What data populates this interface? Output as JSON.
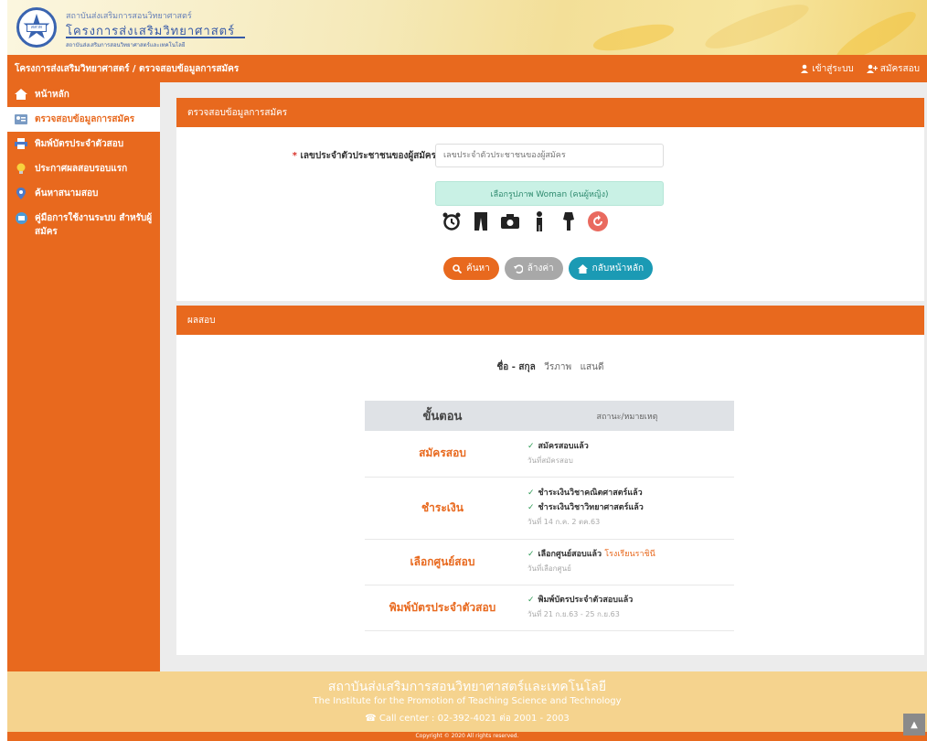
{
  "banner": {
    "line1": "สถาบันส่งเสริมการสอนวิทยาศาสตร์",
    "line2": "โครงการส่งเสริมวิทยาศาสตร์",
    "line3": "สถาบันส่งเสริมการสอนวิทยาศาสตร์และเทคโนโลยี",
    "logo_text": "สสวท"
  },
  "topbar": {
    "breadcrumb": "โครงการส่งเสริมวิทยาศาสตร์ / ตรวจสอบข้อมูลการสมัคร",
    "user_link": "เข้าสู่ระบบ",
    "register_link": "สมัครสอบ"
  },
  "sidebar": {
    "items": [
      {
        "label": "หน้าหลัก",
        "icon": "home-icon"
      },
      {
        "label": "ตรวจสอบข้อมูลการสมัคร",
        "icon": "id-card-icon"
      },
      {
        "label": "พิมพ์บัตรประจำตัวสอบ",
        "icon": "printer-icon"
      },
      {
        "label": "ประกาศผลสอบรอบแรก",
        "icon": "lightbulb-icon"
      },
      {
        "label": "ค้นหาสนามสอบ",
        "icon": "map-pin-icon"
      },
      {
        "label": "คู่มือการใช้งานระบบ สำหรับผู้สมัคร",
        "icon": "book-icon"
      }
    ]
  },
  "check_panel": {
    "title": "ตรวจสอบข้อมูลการสมัคร",
    "id_label": "เลขประจำตัวประชาชนของผู้สมัคร",
    "id_placeholder": "เลขประจำตัวประชาชนของผู้สมัคร",
    "notice": "เลือกรูปภาพ Woman (คนผู้หญิง)",
    "captcha_icons": [
      "alarm-clock-icon",
      "pants-icon",
      "camera-icon",
      "person-icon",
      "dress-icon",
      "refresh-icon"
    ],
    "buttons": {
      "search": "ค้นหา",
      "reset": "ล้างค่า",
      "home": "กลับหน้าหลัก"
    }
  },
  "result_panel": {
    "title": "ผลสอบ",
    "summary_name": "ชื่อ - สกุล",
    "summary_first": "วีรภาพ",
    "summary_last": "แสนดี",
    "columns": {
      "step": "ขั้นตอน",
      "detail": "สถานะ/หมายเหตุ"
    },
    "rows": [
      {
        "step": "สมัครสอบ",
        "lines": [
          "สมัครสอบแล้ว"
        ],
        "extra": "",
        "sub": "วันที่สมัครสอบ"
      },
      {
        "step": "ชำระเงิน",
        "lines": [
          "ชำระเงินวิชาคณิตศาสตร์แล้ว",
          "ชำระเงินวิชาวิทยาศาสตร์แล้ว"
        ],
        "extra": "",
        "sub": "วันที่ 14 ก.ค. 2 ตค.63"
      },
      {
        "step": "เลือกศูนย์สอบ",
        "lines": [
          "เลือกศูนย์สอบแล้ว"
        ],
        "extra": "โรงเรียนราชินี",
        "sub": "วันที่เลือกศูนย์"
      },
      {
        "step": "พิมพ์บัตรประจำตัวสอบ",
        "lines": [
          "พิมพ์บัตรประจำตัวสอบแล้ว"
        ],
        "extra": "",
        "sub": "วันที่ 21 ก.ย.63 - 25 ก.ย.63"
      }
    ]
  },
  "footer": {
    "org_th": "สถาบันส่งเสริมการสอนวิทยาศาสตร์และเทคโนโลยี",
    "org_en": "The Institute for the Promotion of Teaching Science and Technology",
    "contact": "Call center : 02-392-4021 ต่อ 2001 - 2003",
    "copyright": "Copyright © 2020 All rights reserved."
  },
  "colors": {
    "primary": "#e8691e",
    "notice_bg": "#c9f1e5",
    "home_btn": "#1b9ab4"
  }
}
